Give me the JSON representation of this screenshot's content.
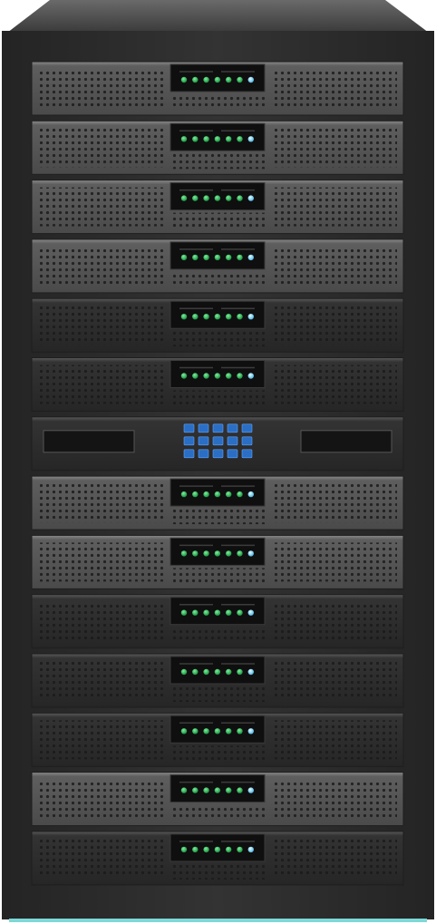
{
  "rack": {
    "units": [
      "server",
      "server",
      "server",
      "server",
      "server",
      "server",
      "control",
      "server",
      "server",
      "server",
      "server",
      "server",
      "server",
      "server"
    ],
    "server_leds": [
      "green",
      "green",
      "green",
      "green",
      "green",
      "green",
      "cyan"
    ],
    "control_keys_rows": 3,
    "control_keys_cols": 5,
    "colors": {
      "frame": "#2c2c2c",
      "frame_top": "#4a4a4a",
      "unit_light": "#5c5c5c",
      "unit_dark": "#2e2e2e",
      "led_green": "#1fa34a",
      "led_cyan": "#7fd8ff",
      "key_blue": "#2b6fc4",
      "base_accent": "#7fd8d8"
    }
  }
}
